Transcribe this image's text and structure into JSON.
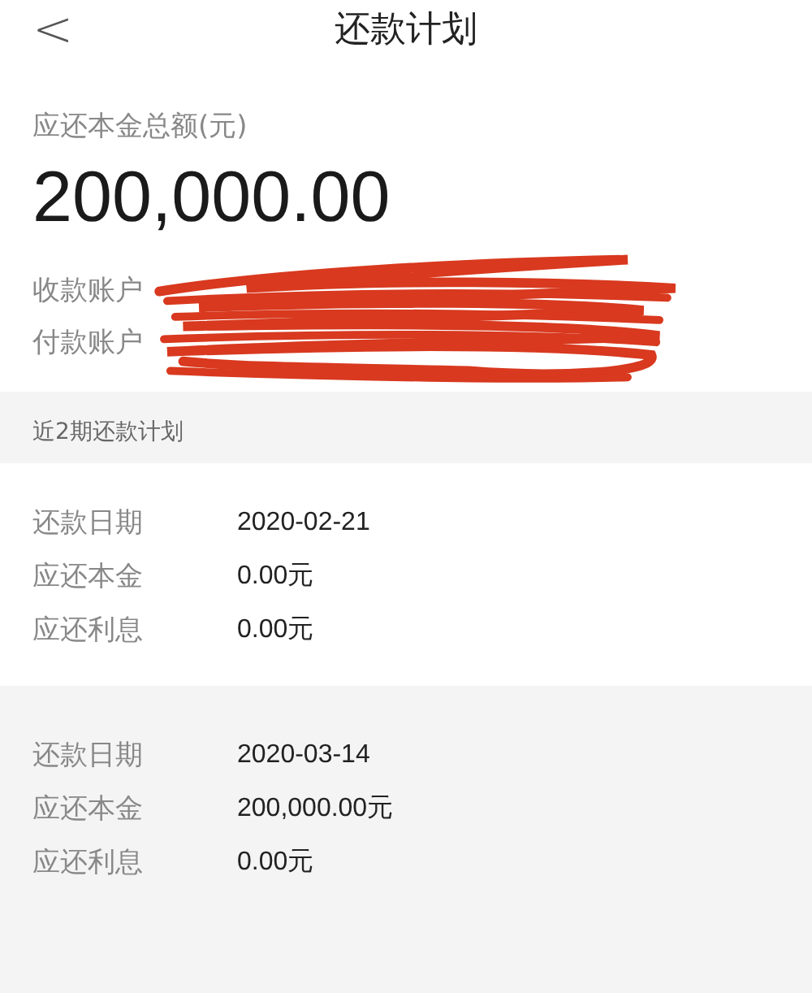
{
  "nav": {
    "back": "<",
    "title": "还款计划"
  },
  "summary": {
    "label": "应还本金总额(元)",
    "amount": "200,000.00",
    "accounts": [
      {
        "label": "收款账户"
      },
      {
        "label": "付款账户"
      }
    ]
  },
  "section_title": "近2期还款计划",
  "plans": [
    {
      "rows": [
        {
          "label": "还款日期",
          "value": "2020-02-21"
        },
        {
          "label": "应还本金",
          "value": "0.00元"
        },
        {
          "label": "应还利息",
          "value": "0.00元"
        }
      ]
    },
    {
      "rows": [
        {
          "label": "还款日期",
          "value": "2020-03-14"
        },
        {
          "label": "应还本金",
          "value": "200,000.00元"
        },
        {
          "label": "应还利息",
          "value": "0.00元"
        }
      ]
    }
  ]
}
